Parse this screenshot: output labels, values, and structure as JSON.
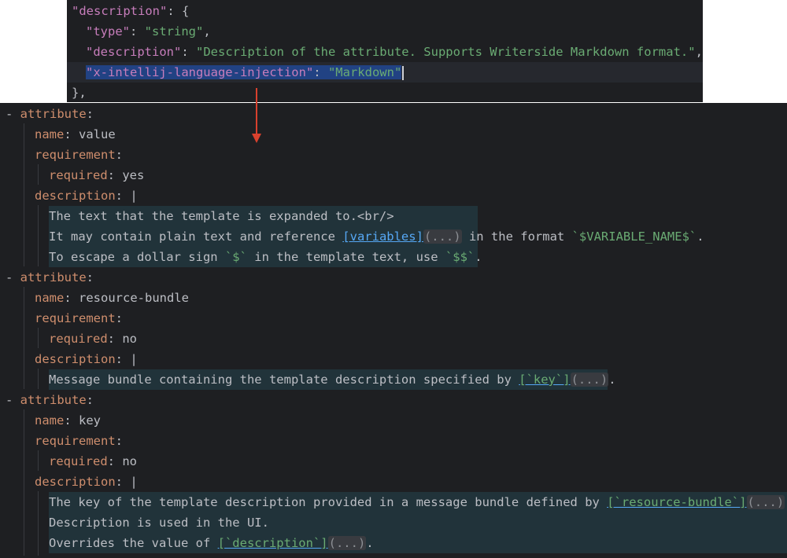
{
  "json_snippet": {
    "lines": [
      {
        "indent": "",
        "key": "\"description\"",
        "sep": ": {",
        "value": "",
        "tail": ""
      },
      {
        "indent": "  ",
        "key": "\"type\"",
        "sep": ": ",
        "value": "\"string\"",
        "tail": ","
      },
      {
        "indent": "  ",
        "key": "\"description\"",
        "sep": ": ",
        "value": "\"Description of the attribute. Supports Writerside Markdown format.\"",
        "tail": ","
      },
      {
        "indent": "  ",
        "key": "\"x-intellij-language-injection\"",
        "sep": ": ",
        "value": "\"Markdown\"",
        "tail": ""
      },
      {
        "text": "},"
      }
    ]
  },
  "yaml": {
    "attr_label": "attribute",
    "name_label": "name",
    "requirement_label": "requirement",
    "required_label": "required",
    "description_label": "description",
    "block_indicator": "|",
    "dash": "- ",
    "fold": "...",
    "attributes": [
      {
        "name": "value",
        "required": "yes",
        "desc": [
          {
            "plain": "The text that the template is expanded to.<br/>"
          },
          {
            "pre": "It may contain plain text and reference ",
            "link": "[variables]",
            "fold": "(...)",
            "mid": " in the format ",
            "code": "`$VARIABLE_NAME$`",
            "post": "."
          },
          {
            "pre": "To escape a dollar sign ",
            "code": "`$`",
            "mid": " in the template text, use ",
            "code2": "`$$`",
            "post": "."
          }
        ]
      },
      {
        "name": "resource-bundle",
        "required": "no",
        "desc": [
          {
            "pre": "Message bundle containing the template description specified by ",
            "link": "[`key`]",
            "fold": "(...)",
            "post": "."
          }
        ]
      },
      {
        "name": "key",
        "required": "no",
        "desc": [
          {
            "pre": "The key of the template description provided in a message bundle defined by ",
            "link": "[`resource-bundle`]",
            "fold": "(...)",
            "post": "."
          },
          {
            "plain": "Description is used in the UI."
          },
          {
            "pre": "Overrides the value of ",
            "link": "[`description`]",
            "fold": "(...)",
            "post": "."
          }
        ]
      }
    ]
  },
  "colors": {
    "editor_bg": "#1e1f22",
    "yaml_key": "#cf8e6d",
    "json_key": "#c77dbb",
    "string": "#6aab73",
    "link": "#56a8f5",
    "injection_bg": "#21333a",
    "selection_bg": "#214283",
    "arrow": "#d9412e"
  }
}
